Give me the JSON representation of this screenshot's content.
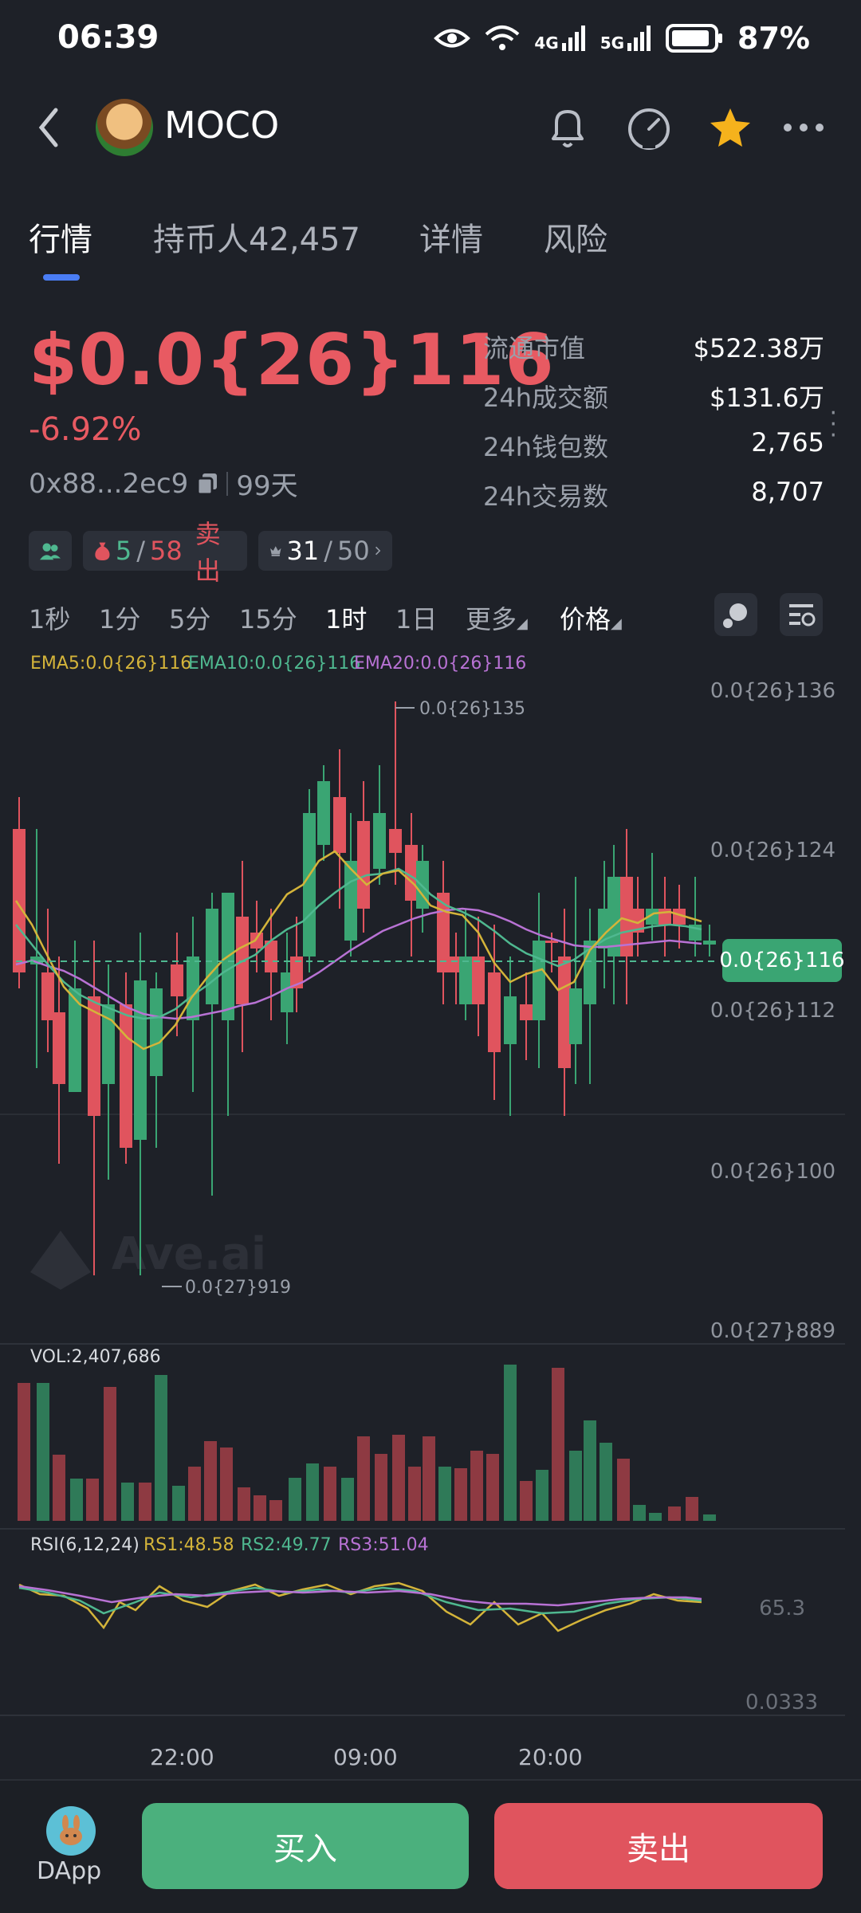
{
  "status_bar": {
    "time": "06:39",
    "battery": "87%",
    "net1": "4G",
    "net2": "5G"
  },
  "header": {
    "coin": "MOCO"
  },
  "tabs": [
    {
      "label": "行情"
    },
    {
      "label": "持币人42,457"
    },
    {
      "label": "详情"
    },
    {
      "label": "风险"
    }
  ],
  "price": {
    "current": "$0.0{26}116",
    "change": "-6.92%",
    "address": "0x88...2ec9",
    "age": "99天"
  },
  "stats": [
    {
      "label": "流通市值",
      "value": "$522.38万"
    },
    {
      "label": "24h成交额",
      "value": "$131.6万"
    },
    {
      "label": "24h钱包数",
      "value": "2,765"
    },
    {
      "label": "24h交易数",
      "value": "8,707"
    }
  ],
  "badges": {
    "count_a": "5",
    "count_b": "58",
    "sell": "卖出",
    "top_a": "31",
    "top_b": "50"
  },
  "intervals": [
    "1秒",
    "1分",
    "5分",
    "15分",
    "1时",
    "1日",
    "更多",
    "价格"
  ],
  "ema": {
    "ema5": "EMA5:0.0{26}116",
    "ema10": "EMA10:0.0{26}116",
    "ema20": "EMA20:0.0{26}116",
    "colors": {
      "ema5": "#d4b43a",
      "ema10": "#4fb890",
      "ema20": "#b872d4"
    }
  },
  "axis": {
    "y_labels": [
      "0.0{26}136",
      "0.0{26}124",
      "0.0{26}112",
      "0.0{26}100",
      "0.0{27}889"
    ],
    "current_tag": "0.0{26}116",
    "high_annotation": "0.0{26}135",
    "low_annotation": "0.0{27}919",
    "rsi_top": "65.3",
    "rsi_bottom": "0.0333",
    "times": [
      "22:00",
      "09:00",
      "20:00"
    ]
  },
  "volume": {
    "label": "VOL:2,407,686"
  },
  "rsi": {
    "label": "RSI(6,12,24)",
    "rs1": "RS1:48.58",
    "rs2": "RS2:49.77",
    "rs3": "RS3:51.04"
  },
  "colors": {
    "up": "#3aa573",
    "down": "#e0545e",
    "accent": "#4a7df5"
  },
  "watermark": "Ave.ai",
  "bottom": {
    "dapp": "DApp",
    "buy": "买入",
    "sell": "卖出"
  }
}
